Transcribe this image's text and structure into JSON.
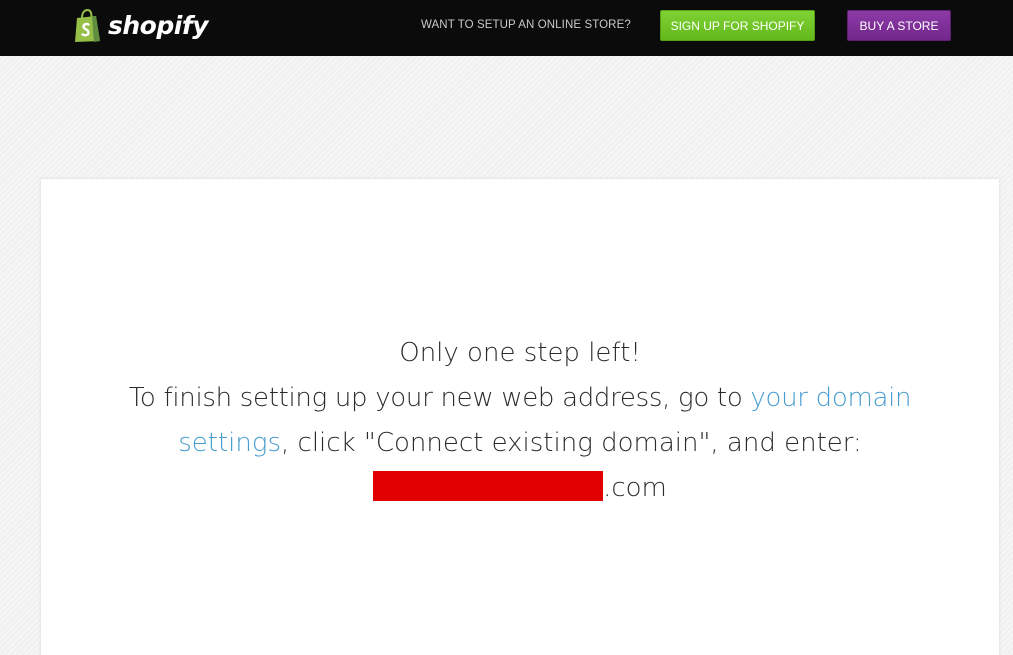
{
  "header": {
    "brand": "shopify",
    "promo_text": "WANT TO SETUP AN ONLINE STORE?",
    "signup_label": "SIGN UP FOR SHOPIFY",
    "buy_label": "BUY A STORE"
  },
  "colors": {
    "header_bg": "#0b0b0b",
    "signup_green": "#6cc424",
    "buy_purple": "#7e2f99",
    "link_blue": "#479ccf",
    "redaction_red": "#e00000",
    "logo_green": "#95bf47"
  },
  "icons": {
    "logo": "shopify-bag-icon"
  },
  "main": {
    "heading": "Only one step left!",
    "instruction_prefix": "To finish setting up your new web address, go to",
    "link_part1": "your domain",
    "link_part2": "settings",
    "instruction_suffix": ", click \"Connect existing domain\", and enter:",
    "domain_suffix": ".com"
  }
}
